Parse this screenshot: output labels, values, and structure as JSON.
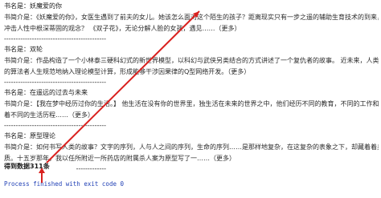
{
  "console": {
    "books": [
      {
        "title": "书名是：妖魔爱的你",
        "desc_1": "书简介是：《妖魔爱的你》，女医生遇到了前夫的女儿。她该怎么面对这个陌生的孩子？距离现实只有一步之遥的辅助生育技术的到来，将如何",
        "desc_2": "冲击人性中根深蒂固的观念？ 《双子花》，无论分解人脸的女孩，遇见……（更多）",
        "divider": "--------------------------------------------"
      },
      {
        "title": "书名是：双轮",
        "desc_1": "书简介是：作品构造了一个小林泰三硬科幻式的新世界模型，以科幻与武侠另类结合的方式讲述了一个复仇者的故事。 近未来，人类将客观具体",
        "desc_2": "的算法者人生规范地纳入理论模型计算，形成能够干涉因果律的Q型网络开发。（更多）",
        "divider": "--------------------------------------------"
      },
      {
        "title": "书名是：在遥远的过去与未来",
        "desc_1": "书简介是：【我在梦中经历过你的生活。】 他生活在没有你的世界里，独生活在未来的世界之中，他们经历不同的教育，不同的工作和社会，有",
        "desc_2": "着不同的生活历程……（更多）",
        "divider": "--------------------------------------------"
      },
      {
        "title": "书名是：原型理论",
        "desc_1": "书简介是：如何书写人类的故事？文字的序列，人与人之间的序列，生命的序列……是那样地复杂，在这复杂的表象之下，却藏着着身为需要的基",
        "desc_2": "质。十五岁那年，我以任所附近一所药店的附属杀人案为原型写了一……（更多）",
        "divider": "--------------------------------------------"
      }
    ],
    "status": "得到数据311条",
    "exit_message": "Process finished with exit code 0"
  },
  "colors": {
    "arrow_red": "#d9211f",
    "exit_blue": "#1f3fb5"
  }
}
